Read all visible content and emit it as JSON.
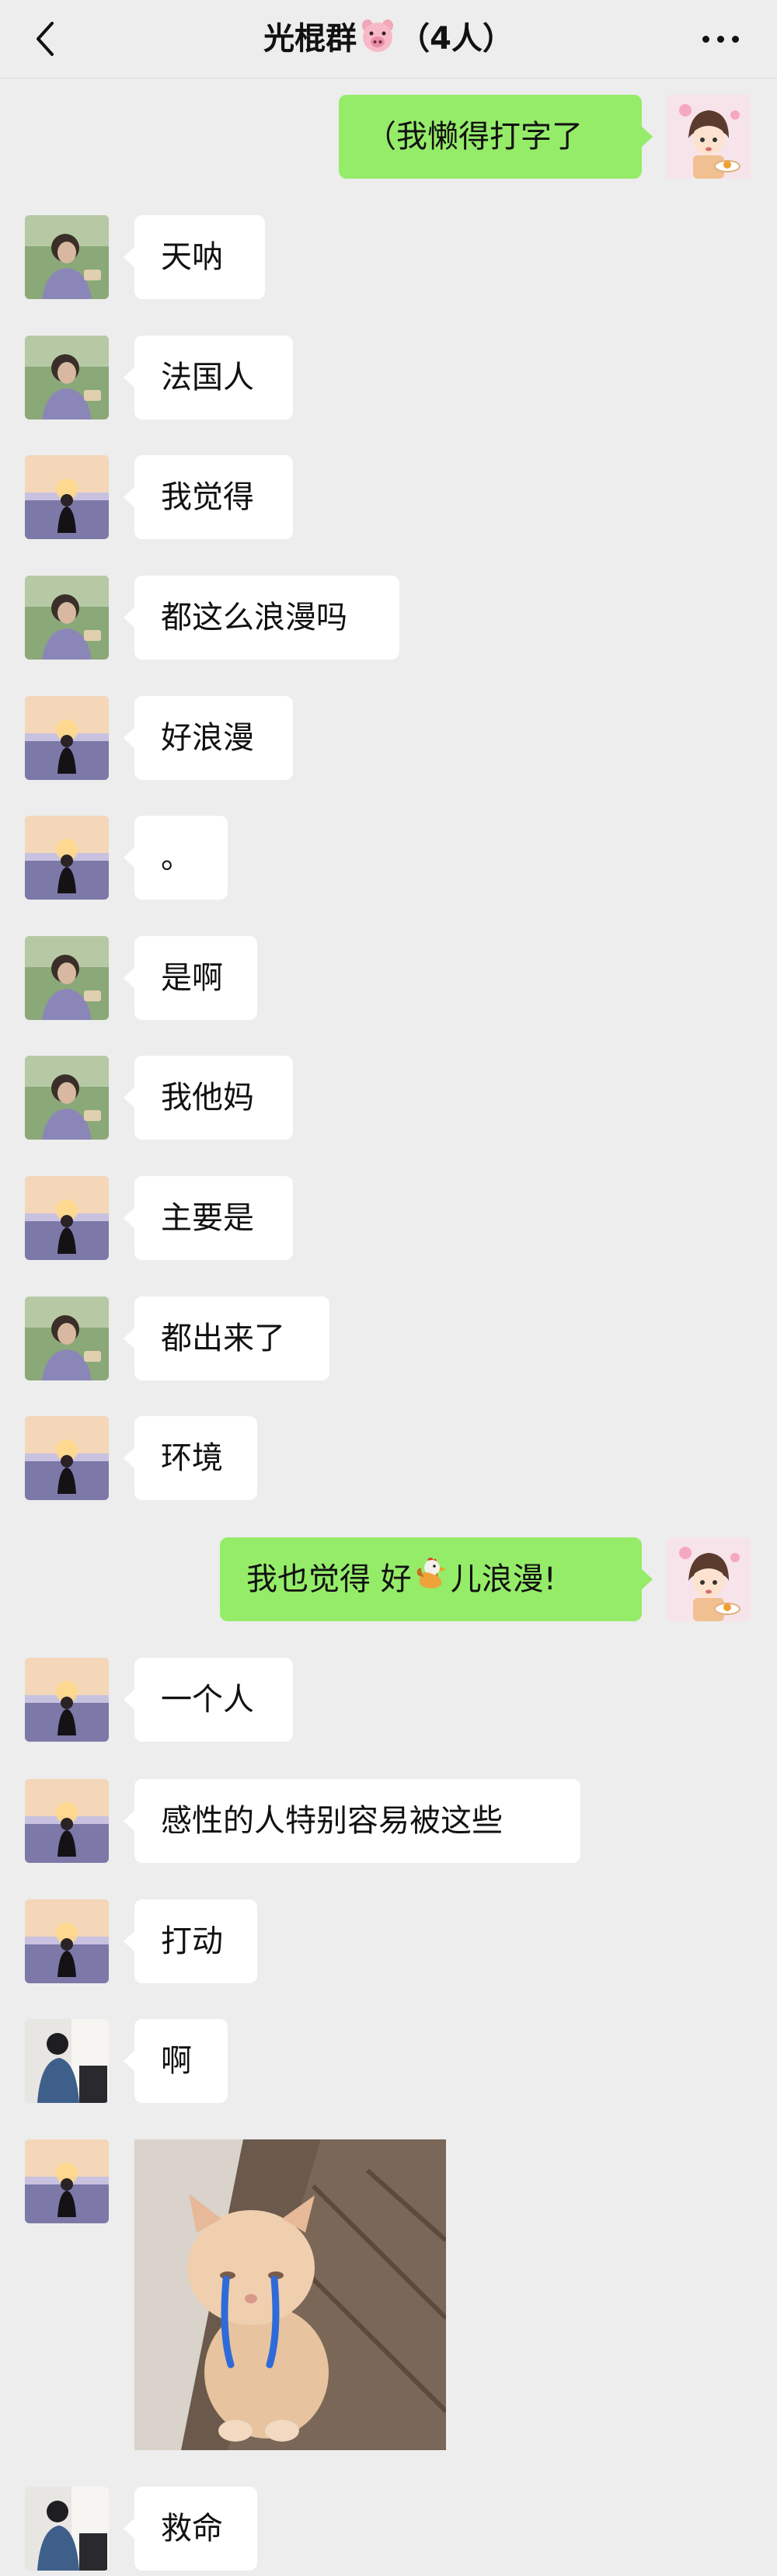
{
  "header": {
    "title": "光棍群",
    "member_count": "（4人）",
    "back_icon": "chevron-left-icon",
    "more_icon": "more-dots-icon",
    "title_emoji": "pig-face-icon"
  },
  "messages": [
    {
      "side": "out",
      "sender": "me",
      "text": "（我懒得打字了"
    },
    {
      "side": "in",
      "sender": "A",
      "text": "天呐"
    },
    {
      "side": "in",
      "sender": "A",
      "text": "法国人"
    },
    {
      "side": "in",
      "sender": "B",
      "text": "我觉得"
    },
    {
      "side": "in",
      "sender": "A",
      "text": "都这么浪漫吗"
    },
    {
      "side": "in",
      "sender": "B",
      "text": "好浪漫"
    },
    {
      "side": "in",
      "sender": "B",
      "text": "。"
    },
    {
      "side": "in",
      "sender": "A",
      "text": "是啊"
    },
    {
      "side": "in",
      "sender": "A",
      "text": "我他妈"
    },
    {
      "side": "in",
      "sender": "B",
      "text": "主要是"
    },
    {
      "side": "in",
      "sender": "A",
      "text": "都出来了"
    },
    {
      "side": "in",
      "sender": "B",
      "text": "环境"
    },
    {
      "side": "out",
      "sender": "me",
      "text_before": "我也觉得 好",
      "emoji": "chicken-icon",
      "text_after": "儿浪漫!"
    },
    {
      "side": "in",
      "sender": "B",
      "text": "一个人"
    },
    {
      "side": "in",
      "sender": "B",
      "text": "感性的人特别容易被这些"
    },
    {
      "side": "in",
      "sender": "B",
      "text": "打动"
    },
    {
      "side": "in",
      "sender": "C",
      "text": "啊"
    },
    {
      "side": "in",
      "sender": "B",
      "type": "image",
      "image": "crying-kitten-sticker"
    },
    {
      "side": "in",
      "sender": "C",
      "text": "救命"
    }
  ],
  "colors": {
    "background": "#ededed",
    "bubble_in": "#ffffff",
    "bubble_out": "#95ec69",
    "text": "#111111"
  }
}
